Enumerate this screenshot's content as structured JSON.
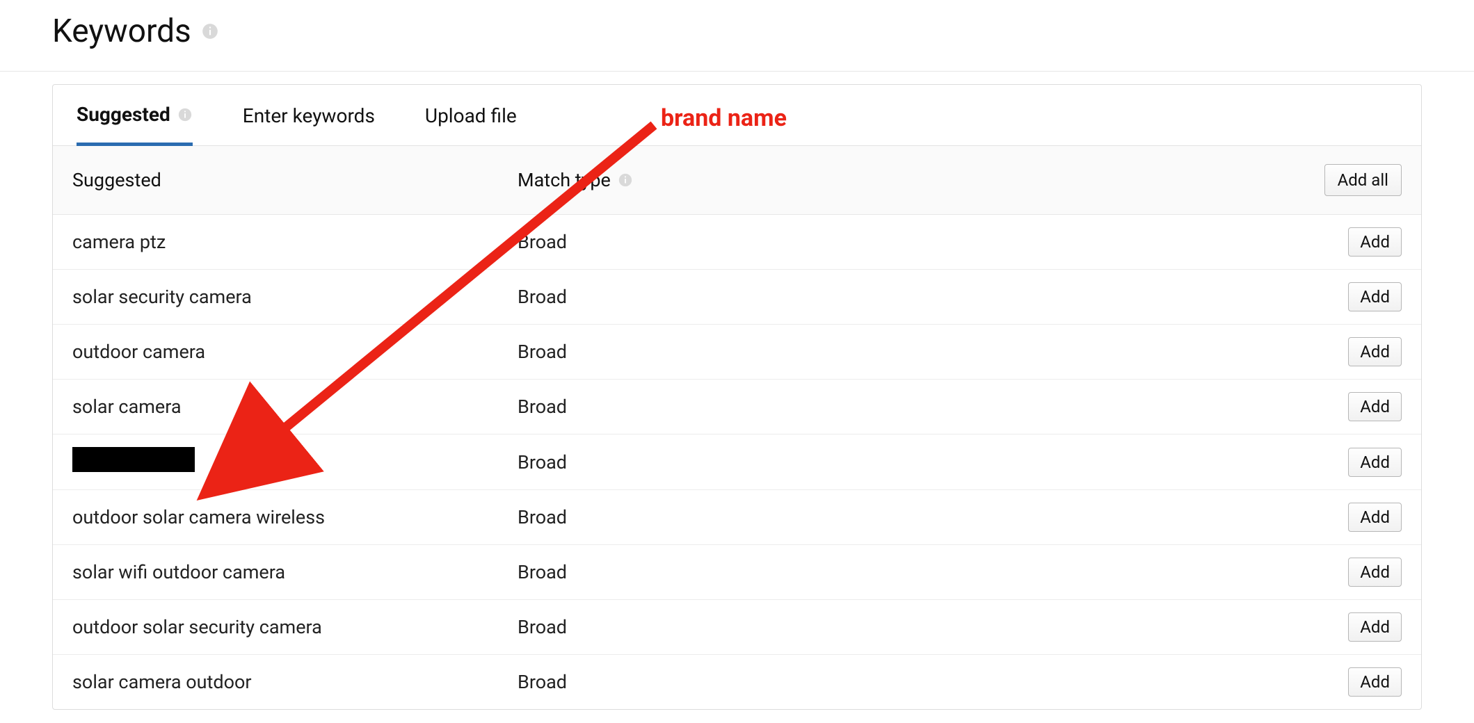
{
  "header": {
    "title": "Keywords"
  },
  "tabs": [
    {
      "label": "Suggested",
      "active": true,
      "has_info": true
    },
    {
      "label": "Enter keywords",
      "active": false,
      "has_info": false
    },
    {
      "label": "Upload file",
      "active": false,
      "has_info": false
    }
  ],
  "table": {
    "columns": {
      "suggested": "Suggested",
      "match_type": "Match type"
    },
    "add_all_label": "Add all",
    "row_add_label": "Add",
    "rows": [
      {
        "keyword": "camera ptz",
        "match": "Broad",
        "redacted": false
      },
      {
        "keyword": "solar security camera",
        "match": "Broad",
        "redacted": false
      },
      {
        "keyword": "outdoor camera",
        "match": "Broad",
        "redacted": false
      },
      {
        "keyword": "solar camera",
        "match": "Broad",
        "redacted": false
      },
      {
        "keyword": "",
        "match": "Broad",
        "redacted": true
      },
      {
        "keyword": "outdoor solar camera wireless",
        "match": "Broad",
        "redacted": false
      },
      {
        "keyword": "solar wifi outdoor camera",
        "match": "Broad",
        "redacted": false
      },
      {
        "keyword": "outdoor solar security camera",
        "match": "Broad",
        "redacted": false
      },
      {
        "keyword": "solar camera outdoor",
        "match": "Broad",
        "redacted": false
      }
    ]
  },
  "annotation": {
    "label": "brand name"
  }
}
